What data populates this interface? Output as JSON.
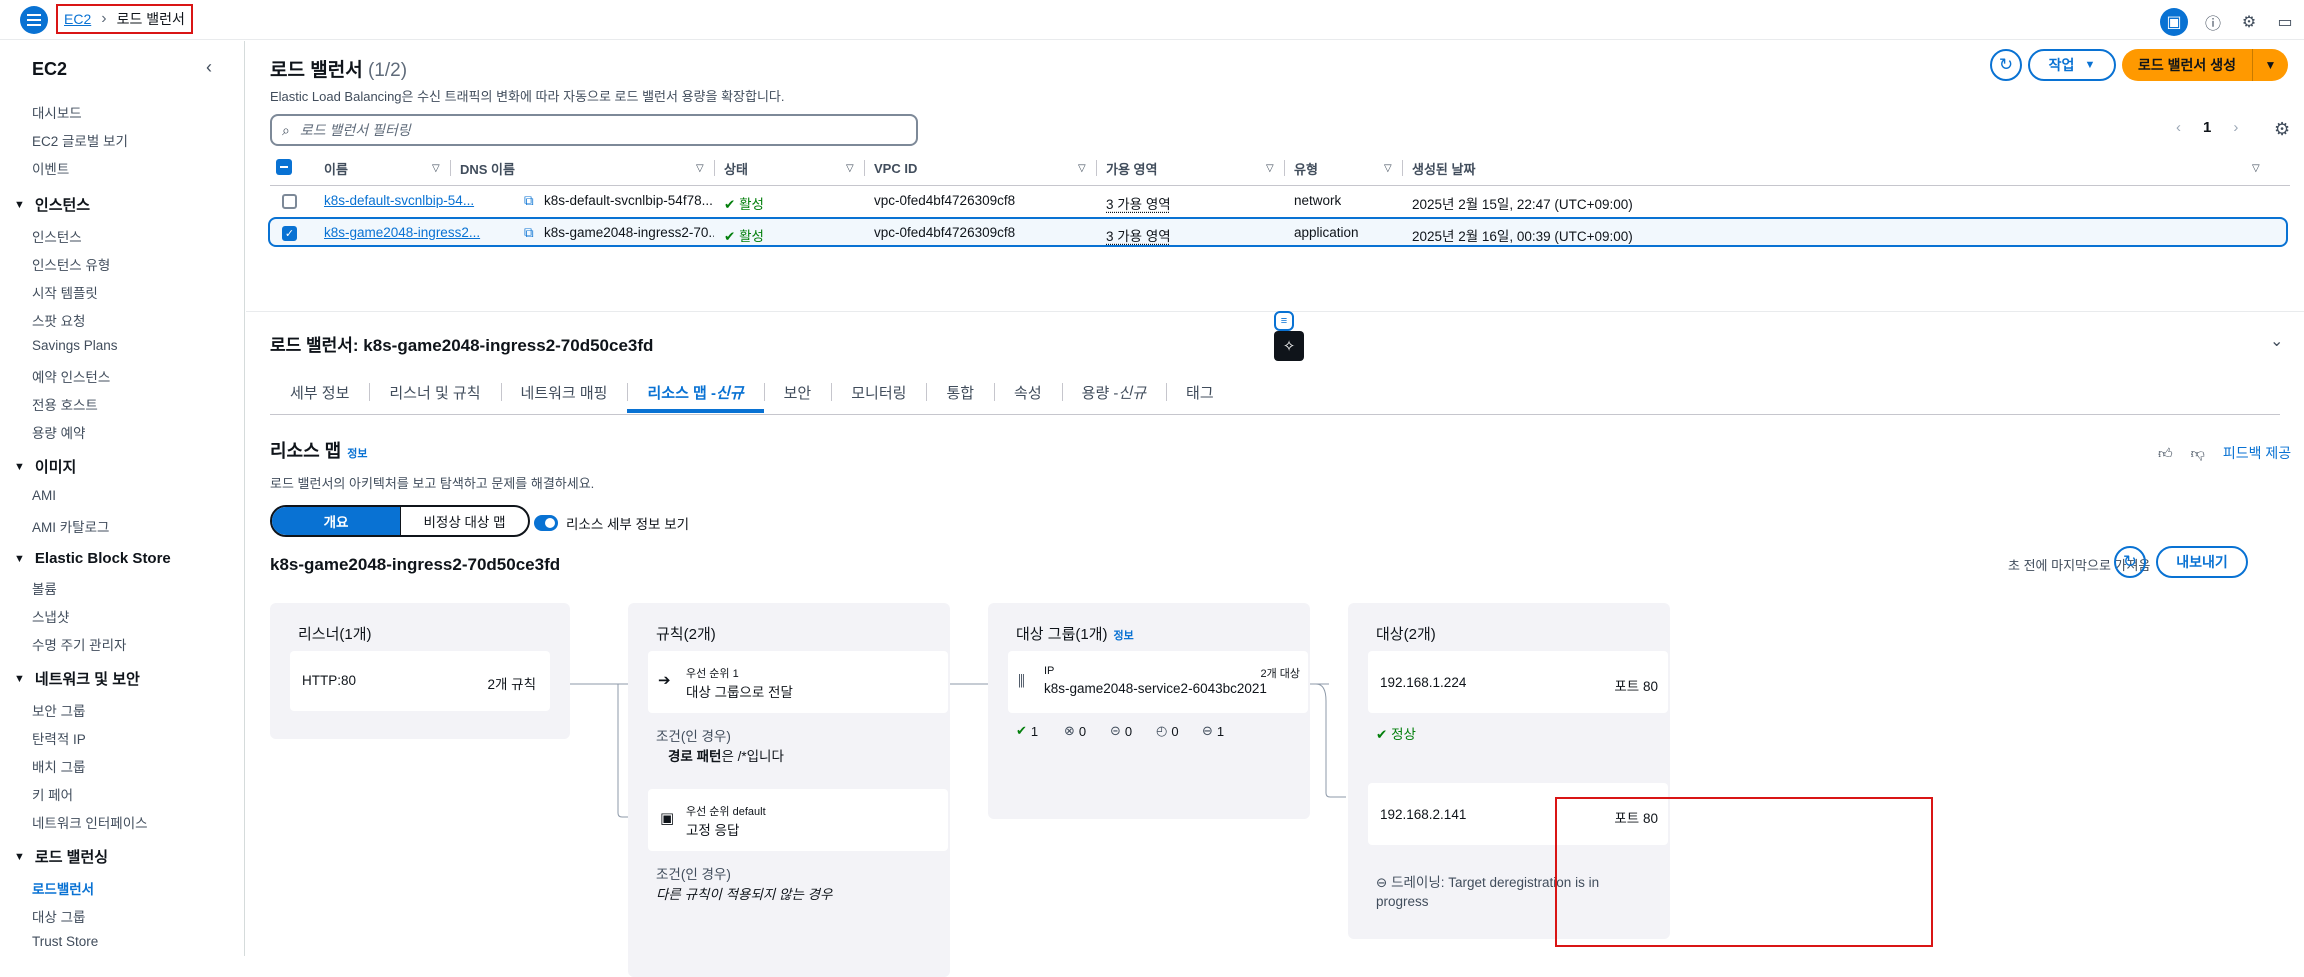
{
  "topbar": {
    "breadcrumb": {
      "root": "EC2",
      "current": "로드 밸런서"
    },
    "icons": [
      "app-icon",
      "info-icon",
      "settings-icon",
      "feedback-icon"
    ]
  },
  "sidebar": {
    "title": "EC2",
    "top_items": [
      "대시보드",
      "EC2 글로벌 보기",
      "이벤트"
    ],
    "sections": [
      {
        "title": "인스턴스",
        "items": [
          "인스턴스",
          "인스턴스 유형",
          "시작 템플릿",
          "스팟 요청",
          "Savings Plans",
          "예약 인스턴스",
          "전용 호스트",
          "용량 예약"
        ]
      },
      {
        "title": "이미지",
        "items": [
          "AMI",
          "AMI 카탈로그"
        ]
      },
      {
        "title": "Elastic Block Store",
        "items": [
          "볼륨",
          "스냅샷",
          "수명 주기 관리자"
        ]
      },
      {
        "title": "네트워크 및 보안",
        "items": [
          "보안 그룹",
          "탄력적 IP",
          "배치 그룹",
          "키 페어",
          "네트워크 인터페이스"
        ]
      },
      {
        "title": "로드 밸런싱",
        "items": [
          "로드밸런서",
          "대상 그룹",
          "Trust Store"
        ]
      }
    ],
    "active": "로드밸런서"
  },
  "header": {
    "title": "로드 밸런서",
    "count": "(1/2)",
    "subtitle": "Elastic Load Balancing은 수신 트래픽의 변화에 따라 자동으로 로드 밸런서 용량을 확장합니다.",
    "actions_label": "작업",
    "create_label": "로드 밸런서 생성",
    "search_placeholder": "로드 밸런서 필터링",
    "page": "1"
  },
  "table": {
    "columns": [
      "이름",
      "DNS 이름",
      "상태",
      "VPC ID",
      "가용 영역",
      "유형",
      "생성된 날짜"
    ],
    "rows": [
      {
        "name": "k8s-default-svcnlbip-54...",
        "dns": "k8s-default-svcnlbip-54f78...",
        "state": "활성",
        "vpc": "vpc-0fed4bf4726309cf8",
        "az": "3 가용 영역",
        "type": "network",
        "created": "2025년 2월 15일, 22:47 (UTC+09:00)",
        "selected": false
      },
      {
        "name": "k8s-game2048-ingress2...",
        "dns": "k8s-game2048-ingress2-70...",
        "state": "활성",
        "vpc": "vpc-0fed4bf4726309cf8",
        "az": "3 가용 영역",
        "type": "application",
        "created": "2025년 2월 16일, 00:39 (UTC+09:00)",
        "selected": true
      }
    ]
  },
  "detail": {
    "title": "로드 밸런서: k8s-game2048-ingress2-70d50ce3fd",
    "tabs": [
      {
        "label": "세부 정보"
      },
      {
        "label": "리스너 및 규칙"
      },
      {
        "label": "네트워크 매핑"
      },
      {
        "label": "리소스 맵 - ",
        "em": "신규",
        "active": true
      },
      {
        "label": "보안"
      },
      {
        "label": "모니터링"
      },
      {
        "label": "통합"
      },
      {
        "label": "속성"
      },
      {
        "label": "용량 - ",
        "em": "신규"
      },
      {
        "label": "태그"
      }
    ]
  },
  "resource_map": {
    "title": "리소스 맵",
    "info": "정보",
    "subtitle": "로드 밸런서의 아키텍처를 보고 탐색하고 문제를 해결하세요.",
    "seg_on": "개요",
    "seg_off": "비정상 대상 맵",
    "toggle_label": "리소스 세부 정보 보기",
    "feedback": "피드백 제공",
    "lb_name": "k8s-game2048-ingress2-70d50ce3fd",
    "fetched": "초 전에 마지막으로 가져옴",
    "export": "내보내기",
    "listeners": {
      "header": "리스너(1개)",
      "name": "HTTP:80",
      "rules": "2개 규칙"
    },
    "rules": {
      "header": "규칙(2개)",
      "r1": {
        "priority": "우선 순위 1",
        "action": "대상 그룹으로 전달",
        "cond_h": "조건(인 경우)",
        "cond_bold": "경로 패턴",
        "cond_rest": "은 /*입니다"
      },
      "r2": {
        "priority": "우선 순위 default",
        "action": "고정 응답",
        "cond_h": "조건(인 경우)",
        "cond": "다른 규칙이 적용되지 않는 경우"
      }
    },
    "target_groups": {
      "header": "대상 그룹(1개)",
      "info": "정보",
      "type": "IP",
      "count": "2개 대상",
      "name": "k8s-game2048-service2-6043bc2021",
      "stats": [
        "1",
        "0",
        "0",
        "0",
        "1"
      ]
    },
    "targets": {
      "header": "대상(2개)",
      "t1": {
        "ip": "192.168.1.224",
        "port": "포트 80",
        "status": "정상"
      },
      "t2": {
        "ip": "192.168.2.141",
        "port": "포트 80",
        "status": "드레이닝: Target deregistration is in progress"
      }
    }
  },
  "colors": {
    "accent": "#0972d3",
    "primary": "#ff9900",
    "success": "#037f0c",
    "highlight": "#d91515"
  }
}
